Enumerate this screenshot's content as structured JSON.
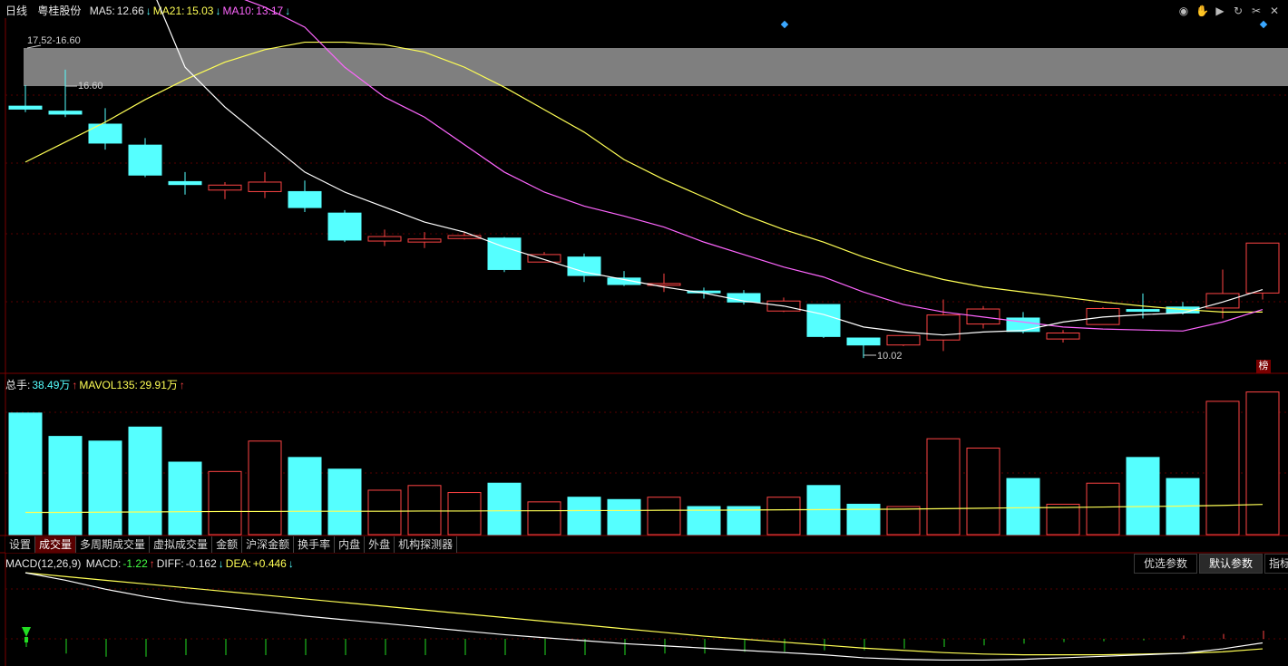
{
  "header": {
    "period": "日线",
    "stock_name": "粤桂股份",
    "ma5_label": "MA5:",
    "ma5_value": "12.66",
    "ma21_label": "MA21:",
    "ma21_value": "15.03",
    "ma10_label": "MA10:",
    "ma10_value": "13.17"
  },
  "price_panel": {
    "range_label": "17.52-16.60",
    "high_label": "16.60",
    "low_label": "10.02",
    "ma_colors": {
      "ma5": "#ffffff",
      "ma10": "#ff66ff",
      "ma21": "#ffff55"
    },
    "rise_color": "#ff4444",
    "fall_color": "#55ffff",
    "candles": [
      {
        "o": 12.42,
        "c": 12.36,
        "h": 12.84,
        "l": 12.3
      },
      {
        "o": 12.32,
        "c": 12.26,
        "h": 13.15,
        "l": 12.2
      },
      {
        "o": 12.06,
        "c": 11.68,
        "h": 12.38,
        "l": 11.55
      },
      {
        "o": 11.64,
        "c": 11.04,
        "h": 11.78,
        "l": 11.0
      },
      {
        "o": 10.91,
        "c": 10.85,
        "h": 11.1,
        "l": 10.65
      },
      {
        "o": 10.74,
        "c": 10.84,
        "h": 10.9,
        "l": 10.56
      },
      {
        "o": 10.71,
        "c": 10.9,
        "h": 11.1,
        "l": 10.58
      },
      {
        "o": 10.71,
        "c": 10.39,
        "h": 10.93,
        "l": 10.3
      },
      {
        "o": 10.28,
        "c": 9.74,
        "h": 10.34,
        "l": 9.7
      },
      {
        "o": 9.72,
        "c": 9.81,
        "h": 9.95,
        "l": 9.62
      },
      {
        "o": 9.7,
        "c": 9.76,
        "h": 9.9,
        "l": 9.58
      },
      {
        "o": 9.77,
        "c": 9.83,
        "h": 9.9,
        "l": 9.75
      },
      {
        "o": 9.78,
        "c": 9.15,
        "h": 9.8,
        "l": 9.1
      },
      {
        "o": 9.3,
        "c": 9.45,
        "h": 9.5,
        "l": 9.3
      },
      {
        "o": 9.4,
        "c": 9.03,
        "h": 9.47,
        "l": 8.9
      },
      {
        "o": 8.98,
        "c": 8.85,
        "h": 9.12,
        "l": 8.82
      },
      {
        "o": 8.84,
        "c": 8.87,
        "h": 9.07,
        "l": 8.7
      },
      {
        "o": 8.72,
        "c": 8.71,
        "h": 8.79,
        "l": 8.57
      },
      {
        "o": 8.67,
        "c": 8.5,
        "h": 8.74,
        "l": 8.45
      },
      {
        "o": 8.32,
        "c": 8.52,
        "h": 8.59,
        "l": 8.3
      },
      {
        "o": 8.45,
        "c": 7.81,
        "h": 8.45,
        "l": 7.78
      },
      {
        "o": 7.78,
        "c": 7.64,
        "h": 7.78,
        "l": 7.38
      },
      {
        "o": 7.64,
        "c": 7.83,
        "h": 7.83,
        "l": 7.62
      },
      {
        "o": 7.74,
        "c": 8.24,
        "h": 8.55,
        "l": 7.52
      },
      {
        "o": 8.06,
        "c": 8.36,
        "h": 8.42,
        "l": 7.97
      },
      {
        "o": 8.18,
        "c": 7.91,
        "h": 8.3,
        "l": 7.87
      },
      {
        "o": 7.76,
        "c": 7.88,
        "h": 7.94,
        "l": 7.69
      },
      {
        "o": 8.05,
        "c": 8.37,
        "h": 8.4,
        "l": 8.05
      },
      {
        "o": 8.35,
        "c": 8.33,
        "h": 8.67,
        "l": 8.17
      },
      {
        "o": 8.4,
        "c": 8.28,
        "h": 8.5,
        "l": 8.25
      },
      {
        "o": 8.38,
        "c": 8.67,
        "h": 9.15,
        "l": 8.17
      },
      {
        "o": 8.68,
        "c": 9.68,
        "h": 9.68,
        "l": 8.55
      }
    ],
    "ma5_line": [
      16.8,
      16.55,
      16.1,
      15.1,
      13.2,
      12.4,
      11.75,
      11.1,
      10.7,
      10.4,
      10.1,
      9.9,
      9.6,
      9.35,
      9.1,
      8.95,
      8.8,
      8.68,
      8.52,
      8.42,
      8.25,
      8.0,
      7.9,
      7.84,
      7.9,
      7.93,
      8.1,
      8.2,
      8.25,
      8.28,
      8.5,
      8.75
    ],
    "ma10_line": [
      16.95,
      16.8,
      16.1,
      15.4,
      14.9,
      14.7,
      14.4,
      14.0,
      13.2,
      12.6,
      12.2,
      11.65,
      11.1,
      10.7,
      10.42,
      10.22,
      10.0,
      9.7,
      9.45,
      9.2,
      9.0,
      8.7,
      8.45,
      8.3,
      8.2,
      8.1,
      8.0,
      7.96,
      7.94,
      7.92,
      8.1,
      8.35
    ],
    "ma21_line": [
      11.3,
      11.7,
      12.1,
      12.55,
      12.95,
      13.3,
      13.55,
      13.7,
      13.7,
      13.65,
      13.5,
      13.2,
      12.8,
      12.35,
      11.9,
      11.35,
      10.95,
      10.6,
      10.25,
      9.95,
      9.7,
      9.4,
      9.15,
      8.95,
      8.8,
      8.7,
      8.6,
      8.5,
      8.42,
      8.35,
      8.3,
      8.3
    ]
  },
  "volume_panel": {
    "total_label": "总手:",
    "total_value": "38.49万",
    "mavol_label": "MAVOL135:",
    "mavol_value": "29.91万",
    "volumes": [
      52,
      42,
      40,
      46,
      31,
      27,
      40,
      33,
      28,
      19,
      21,
      18,
      22,
      14,
      16,
      15,
      16,
      12,
      12,
      16,
      21,
      13,
      12,
      41,
      37,
      24,
      13,
      22,
      33,
      24,
      57,
      61
    ],
    "mavol_line": [
      9.5,
      9.5,
      9.6,
      9.7,
      9.8,
      9.9,
      9.9,
      10.0,
      10.0,
      10.0,
      10.1,
      10.1,
      10.2,
      10.2,
      10.3,
      10.3,
      10.4,
      10.4,
      10.5,
      10.6,
      10.7,
      10.8,
      10.9,
      11.1,
      11.3,
      11.5,
      11.6,
      11.8,
      12.0,
      12.2,
      12.5,
      12.9
    ]
  },
  "tabs": [
    {
      "label": "设置",
      "badge": "",
      "active": false
    },
    {
      "label": "成交量",
      "badge": "",
      "active": true
    },
    {
      "label": "多周期成交量",
      "badge": "",
      "active": false
    },
    {
      "label": "虚拟成交量",
      "badge": "",
      "active": false
    },
    {
      "label": "金额",
      "badge": "",
      "active": false
    },
    {
      "label": "沪深金额",
      "badge": "",
      "active": false
    },
    {
      "label": "换手率",
      "badge": "",
      "active": false
    },
    {
      "label": "内盘",
      "badge": "",
      "active": false
    },
    {
      "label": "外盘",
      "badge": "",
      "active": false
    },
    {
      "label": "机构探测器",
      "badge": "",
      "active": false
    }
  ],
  "macd_panel": {
    "title": "MACD(12,26,9)",
    "macd_label": "MACD:",
    "macd_value": "-1.22",
    "diff_label": "DIFF:",
    "diff_value": "-0.162",
    "dea_label": "DEA:",
    "dea_value": "+0.446",
    "buttons": {
      "optimize": "优选参数",
      "default": "默认参数",
      "indicator": "指标"
    },
    "dif_line": [
      0.0,
      -0.1,
      -0.22,
      -0.32,
      -0.4,
      -0.46,
      -0.52,
      -0.58,
      -0.63,
      -0.68,
      -0.73,
      -0.78,
      -0.83,
      -0.87,
      -0.91,
      -0.95,
      -0.98,
      -1.01,
      -1.04,
      -1.07,
      -1.1,
      -1.14,
      -1.16,
      -1.17,
      -1.17,
      -1.16,
      -1.14,
      -1.12,
      -1.1,
      -1.08,
      -1.02,
      -0.94
    ],
    "dea_line": [
      0.0,
      -0.05,
      -0.1,
      -0.15,
      -0.2,
      -0.25,
      -0.3,
      -0.35,
      -0.4,
      -0.45,
      -0.5,
      -0.55,
      -0.6,
      -0.65,
      -0.7,
      -0.75,
      -0.8,
      -0.85,
      -0.89,
      -0.93,
      -0.97,
      -1.01,
      -1.04,
      -1.07,
      -1.09,
      -1.1,
      -1.1,
      -1.1,
      -1.09,
      -1.08,
      -1.06,
      -1.02
    ],
    "bars": [
      -0.1,
      -0.18,
      -0.22,
      -0.22,
      -0.2,
      -0.2,
      -0.2,
      -0.2,
      -0.2,
      -0.2,
      -0.2,
      -0.2,
      -0.2,
      -0.2,
      -0.2,
      -0.2,
      -0.18,
      -0.18,
      -0.16,
      -0.16,
      -0.14,
      -0.14,
      -0.12,
      -0.1,
      -0.08,
      -0.06,
      -0.04,
      -0.03,
      -0.02,
      0.04,
      0.06,
      0.1
    ]
  }
}
